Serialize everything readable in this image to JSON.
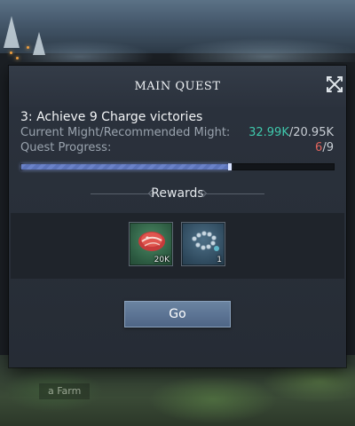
{
  "dialog": {
    "title": "MAIN QUEST",
    "quest": {
      "line": "3: Achieve 9 Charge victories",
      "might_label": "Current Might/Recommended Might:",
      "might_current": "32.99K",
      "might_separator": "/",
      "might_recommended": "20.95K",
      "progress_label": "Quest Progress:",
      "progress_done": "6",
      "progress_separator": "/",
      "progress_total": "9",
      "progress_fraction": 0.667
    },
    "rewards": {
      "heading": "Rewards",
      "items": [
        {
          "icon": "meat-icon",
          "count": "20K"
        },
        {
          "icon": "bead-chain-icon",
          "count": "1"
        }
      ]
    },
    "go_label": "Go"
  },
  "background": {
    "map_label": "a Farm"
  },
  "colors": {
    "might_current": "#3fc8ac",
    "progress_done": "#e0645d",
    "progress_fill": "#6a82c8",
    "go_button": "#5b7393"
  }
}
